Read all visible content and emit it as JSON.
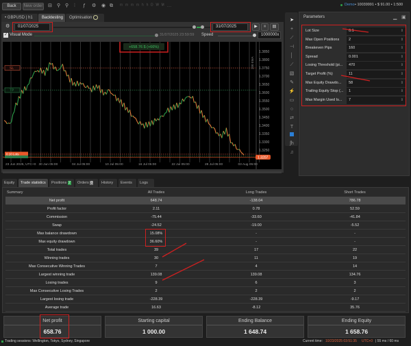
{
  "topbar": {
    "back": "Back",
    "new_order": "New order",
    "account": "Demo",
    "account_info": "• 10039991 • $ 91.00 • 1:500"
  },
  "tabs": {
    "symbol": "GBPUSD",
    "timeframe": "h1",
    "backtesting": "Backtesting",
    "optimisation": "Optimisation"
  },
  "controls": {
    "start_date": "01/07/2025",
    "end_date": "31/07/2025",
    "visual_mode": "Visual Mode",
    "current_sim_time": "31/07/2025 23:59:59",
    "speed_label": "Speed",
    "speed_value": "1000000x"
  },
  "chart": {
    "banner": "+658.76 $ (+66%)",
    "sl_label": "SL",
    "tp_label": "TP",
    "side_label": "200 EMA",
    "price_labels": [
      "1.3850",
      "1.3800",
      "1.3750",
      "1.3700",
      "1.3650",
      "1.3600",
      "1.3550",
      "1.3500",
      "1.3450",
      "1.3400",
      "1.3350",
      "1.3300",
      "1.3250"
    ],
    "current_price": "1.3207",
    "time_labels": [
      "23 Jun 2025, UTC+0",
      "30 Jun 05:00",
      "04 Jul 05:00",
      "10 Jul 05:00",
      "16 Jul 05:00",
      "22 Jul 05:00",
      "28 Jul 05:00",
      "03 Aug 05:00"
    ],
    "order_label": "0.10 Lots",
    "price_range": [
      1.32,
      1.388
    ],
    "price_path": [
      1.343,
      1.34,
      1.352,
      1.36,
      1.364,
      1.372,
      1.374,
      1.372,
      1.378,
      1.373,
      1.376,
      1.369,
      1.365,
      1.366,
      1.364,
      1.362,
      1.364,
      1.359,
      1.361,
      1.357,
      1.354,
      1.35,
      1.346,
      1.342,
      1.34,
      1.341,
      1.343,
      1.345,
      1.349,
      1.351,
      1.353,
      1.357,
      1.358,
      1.352,
      1.346,
      1.341,
      1.337,
      1.333,
      1.337,
      1.329,
      1.326,
      1.322
    ],
    "sl_price": 1.375,
    "tp_price": 1.3615,
    "red_line": 1.3225,
    "green_line": 1.3213,
    "colors": {
      "up": "#2e9e4a",
      "down": "#e07b39",
      "sl": "#c0503a",
      "tp": "#2e7d4a",
      "price_tag": "#e8582a"
    }
  },
  "parameters": {
    "title": "Parameters",
    "items": [
      {
        "label": "Lot Size",
        "value": "0.1"
      },
      {
        "label": "Max Open Positions",
        "value": "2"
      },
      {
        "label": "Breakeven Pips",
        "value": "160"
      },
      {
        "label": "Spread",
        "value": "0.001"
      },
      {
        "label": "Losing Threshold (pi...",
        "value": "470"
      },
      {
        "label": "Target Profit (%)",
        "value": "11"
      },
      {
        "label": "Max Equity Drawdo...",
        "value": "58"
      },
      {
        "label": "Trailing Equity Stop (...",
        "value": "1"
      },
      {
        "label": "Max Margin Used Is...",
        "value": "7"
      }
    ]
  },
  "bottom_tabs": [
    {
      "label": "Equity"
    },
    {
      "label": "Trade statistics",
      "active": true
    },
    {
      "label": "Positions",
      "badge": "2"
    },
    {
      "label": "Orders",
      "badge": "0"
    },
    {
      "label": "History"
    },
    {
      "label": "Events"
    },
    {
      "label": "Logs"
    }
  ],
  "stats_table": {
    "headers": [
      "Summary",
      "All Trades",
      "Long Trades",
      "Short Trades"
    ],
    "rows": [
      [
        "Net profit",
        "648.74",
        "-138.04",
        "786.78"
      ],
      [
        "Profit factor",
        "2.11",
        "0.78",
        "52.59"
      ],
      [
        "Commission",
        "-75.44",
        "-33.60",
        "-41.84"
      ],
      [
        "Swap",
        "-24.52",
        "-19.00",
        "-5.52"
      ],
      [
        "Max balance drawdown",
        "15.08%",
        "-",
        "-"
      ],
      [
        "Max equity drawdown",
        "36.60%",
        "-",
        "-"
      ],
      [
        "Total trades",
        "39",
        "17",
        "22"
      ],
      [
        "Winning trades",
        "30",
        "11",
        "19"
      ],
      [
        "Max Consecutive Winning Trades",
        "7",
        "4",
        "14"
      ],
      [
        "Largest winning trade",
        "139.08",
        "139.08",
        "134.76"
      ],
      [
        "Losing trades",
        "9",
        "6",
        "3"
      ],
      [
        "Max Consecutive Losing Trades",
        "2",
        "2",
        "2"
      ],
      [
        "Largest losing trade",
        "-228.39",
        "-228.39",
        "-9.17"
      ],
      [
        "Average trade",
        "16.63",
        "-8.12",
        "35.76"
      ]
    ]
  },
  "summary": [
    {
      "label": "Net profit",
      "value": "658.76"
    },
    {
      "label": "Starting capital",
      "value": "1 000.00"
    },
    {
      "label": "Ending Balance",
      "value": "1 648.74"
    },
    {
      "label": "Ending Equity",
      "value": "1 658.76"
    }
  ],
  "statusbar": {
    "sessions": "Trading sessions: Wellington, Tokyo, Sydney, Singapore",
    "current_time_label": "Current time:",
    "current_time": "10/23/2025 03:51:35",
    "utc": "UTC+0",
    "latency": "| 55 ms / 60 ms"
  }
}
